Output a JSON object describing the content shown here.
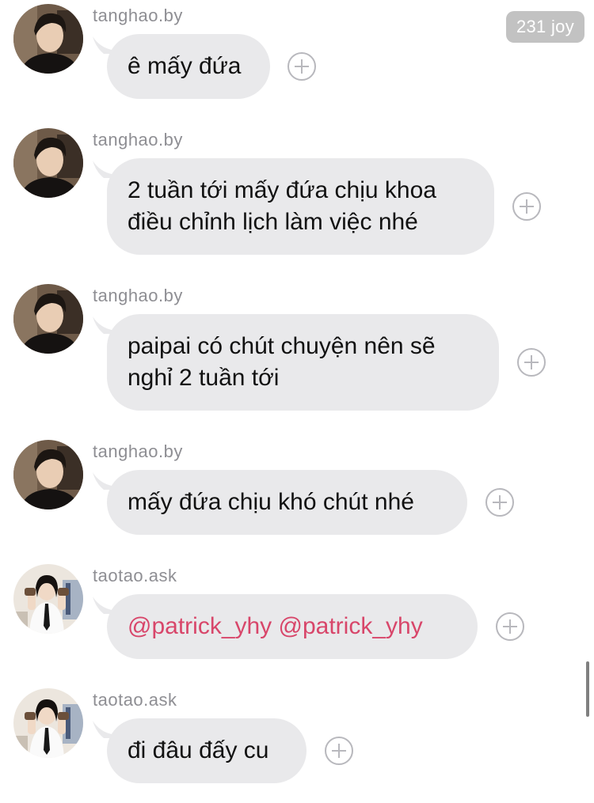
{
  "badge": {
    "count_label": "231 joy"
  },
  "messages": [
    {
      "user": "tanghao.by",
      "avatar_icon": "male-selfie-avatar-icon",
      "text": "ê mấy đứa"
    },
    {
      "user": "tanghao.by",
      "avatar_icon": "male-selfie-avatar-icon",
      "text": "2 tuần tới mấy đứa chịu khoa điều chỉnh lịch làm việc nhé"
    },
    {
      "user": "tanghao.by",
      "avatar_icon": "male-selfie-avatar-icon",
      "text": "paipai có chút chuyện nên sẽ nghỉ 2 tuần tới"
    },
    {
      "user": "tanghao.by",
      "avatar_icon": "male-selfie-avatar-icon",
      "text": "mấy đứa chịu khó chút nhé"
    },
    {
      "user": "taotao.ask",
      "avatar_icon": "girl-uniform-avatar-icon",
      "text": "@patrick_yhy @patrick_yhy"
    },
    {
      "user": "taotao.ask",
      "avatar_icon": "girl-uniform-avatar-icon",
      "text": "đi đâu đấy cu"
    }
  ],
  "colors": {
    "bubble": "#e9e9eb",
    "mention": "#d8466a",
    "username": "#8e8e93",
    "badge": "#c2c2c2"
  },
  "icons": {
    "react": "add-reaction-plus-icon"
  }
}
